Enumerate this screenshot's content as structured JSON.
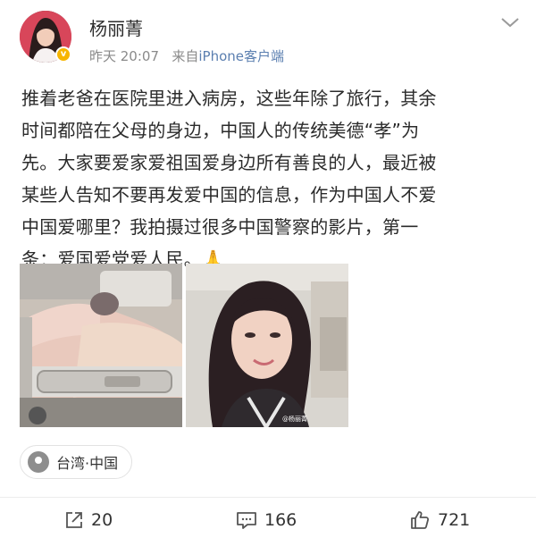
{
  "post": {
    "username": "杨丽菁",
    "time": "昨天 20:07",
    "source_prefix": "来自",
    "source": "iPhone客户端",
    "text_lines": [
      "推着老爸在医院里进入病房，这些年除了旅行，其余",
      "时间都陪在父母的身边，中国人的传统美德“孝”为",
      "先。大家要爱家爱祖国爱身边所有善良的人，最近被",
      "某些人告知不要再发爱中国的信息，作为中国人不爱",
      "中国爱哪里？我拍摄过很多中国警察的影片，第一",
      "条：爱国爱党爱人民。🙏"
    ],
    "watermark": "@杨丽菁",
    "location": "台湾·中国"
  },
  "actions": {
    "share_count": "20",
    "comment_count": "166",
    "like_count": "721"
  },
  "colors": {
    "link": "#5b7fb0",
    "verified": "#f7b500",
    "meta": "#8a8a8a"
  }
}
